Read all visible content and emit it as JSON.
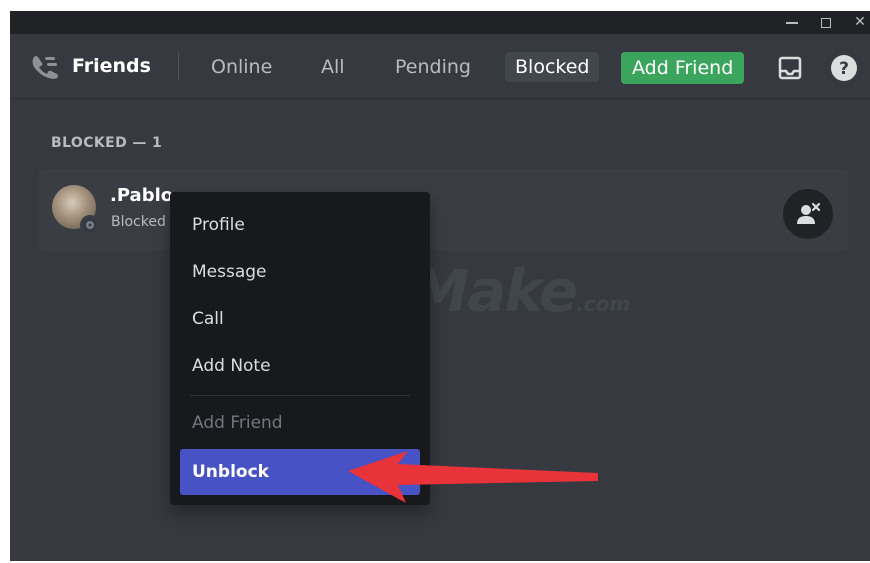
{
  "window": {
    "controls": [
      "minimize",
      "maximize",
      "close"
    ],
    "close_glyph": "✕"
  },
  "header": {
    "friends_icon": "friends-wave-icon",
    "title": "Friends",
    "tabs": [
      {
        "label": "Online",
        "active": false
      },
      {
        "label": "All",
        "active": false
      },
      {
        "label": "Pending",
        "active": false
      },
      {
        "label": "Blocked",
        "active": true
      }
    ],
    "add_friend_label": "Add Friend",
    "inbox_icon": "inbox-icon",
    "help_icon": "help-icon"
  },
  "blocked_section": {
    "heading": "BLOCKED — 1",
    "friend": {
      "name": ".Pablo",
      "status": "Blocked",
      "action_icon": "unblock-user-icon"
    }
  },
  "context_menu": {
    "items": [
      {
        "label": "Profile",
        "disabled": false
      },
      {
        "label": "Message",
        "disabled": false
      },
      {
        "label": "Call",
        "disabled": false
      },
      {
        "label": "Add Note",
        "disabled": false
      },
      {
        "label": "Add Friend",
        "disabled": true
      },
      {
        "label": "Unblock",
        "highlighted": true
      }
    ]
  },
  "watermark": {
    "main": "TipsMake",
    "suffix": ".com"
  },
  "colors": {
    "background": "#36393f",
    "titlebar": "#202225",
    "add_friend_green": "#3ba55d",
    "menu_highlight": "#4752c4",
    "arrow_red": "#e8333a"
  }
}
